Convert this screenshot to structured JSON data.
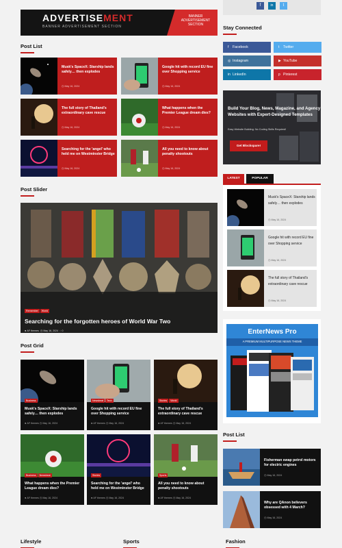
{
  "ad": {
    "title_main": "ADVERTISE",
    "title_accent": "MENT",
    "subtitle": "BANNER ADVERTISEMENT SECTION",
    "side_text": "BANNER ADVERTISEMENT SECTION"
  },
  "post_list": {
    "heading": "Post List",
    "items": [
      {
        "title": "Musk's SpaceX: Starship lands safely… then explodes",
        "date": "May 16, 2024"
      },
      {
        "title": "Google hit with record EU fine over Shopping service",
        "date": "May 16, 2024"
      },
      {
        "title": "The full story of Thailand's extraordinary cave rescue",
        "date": "May 16, 2024"
      },
      {
        "title": "What happens when the Premier League dream dies?",
        "date": "May 16, 2024"
      },
      {
        "title": "Searching for the 'angel' who held me on Westminster Bridge",
        "date": "May 16, 2024"
      },
      {
        "title": "All you need to know about penalty shootouts",
        "date": "May 16, 2024"
      }
    ]
  },
  "post_slider": {
    "heading": "Post Slider",
    "badges": [
      "Remember",
      "World"
    ],
    "title": "Searching for the forgotten heroes of World War Two",
    "author": "AF themes",
    "date": "May 16, 2024",
    "comments": "0"
  },
  "post_grid": {
    "heading": "Post Grid",
    "items": [
      {
        "badges": [
          "Business"
        ],
        "title": "Musk's SpaceX: Starship lands safely… then explodes",
        "author": "AF themes",
        "date": "May 16, 2024"
      },
      {
        "badges": [
          "Newsbeat",
          "Tech"
        ],
        "title": "Google hit with record EU fine over Shopping service",
        "author": "AF themes",
        "date": "May 16, 2024"
      },
      {
        "badges": [
          "Stories",
          "World"
        ],
        "title": "The full story of Thailand's extraordinary cave rescue",
        "author": "AF themes",
        "date": "May 16, 2024"
      },
      {
        "badges": [
          "Business",
          "Newsbeat"
        ],
        "title": "What happens when the Premier League dream dies?",
        "author": "AF themes",
        "date": "May 16, 2024"
      },
      {
        "badges": [
          "Stories"
        ],
        "title": "Searching for the 'angel' who held me on Westminster Bridge",
        "author": "AF themes",
        "date": "May 16, 2024"
      },
      {
        "badges": [
          "Sports"
        ],
        "title": "All you need to know about penalty shootouts",
        "author": "AF themes",
        "date": "May 16, 2024"
      }
    ]
  },
  "sidebar": {
    "stay_connected": "Stay Connected",
    "social": [
      {
        "label": "Facebook",
        "icon": "f",
        "color": "#3b5998"
      },
      {
        "label": "Twitter",
        "icon": "t",
        "color": "#55acee"
      },
      {
        "label": "Instagram",
        "icon": "◎",
        "color": "#3f729b"
      },
      {
        "label": "YouTube",
        "icon": "▶",
        "color": "#c4302b"
      },
      {
        "label": "LinkedIn",
        "icon": "in",
        "color": "#0e76a8"
      },
      {
        "label": "Pinterest",
        "icon": "p",
        "color": "#c8232c"
      }
    ],
    "promo": {
      "title": "Build Your Blog, News, Magazine, and Agency Websites with Expert-Designed Templates",
      "subtitle": "Easy Website Building: No Coding Skills Required!",
      "button": "Get Blockspare!"
    },
    "tabs": {
      "latest": "LATEST",
      "popular": "POPULAR"
    },
    "latest": [
      {
        "title": "Musk's SpaceX: Starship lands safely… then explodes",
        "date": "May 16, 2024"
      },
      {
        "title": "Google hit with record EU fine over Shopping service",
        "date": "May 16, 2024"
      },
      {
        "title": "The full story of Thailand's extraordinary cave rescue",
        "date": "May 16, 2024"
      }
    ],
    "enternews": {
      "title": "EnterNews Pro",
      "tagline": "A PREMIUM MULTIPURPOSE NEWS THEME"
    },
    "post_list_heading": "Post List",
    "post_list": [
      {
        "title": "Fisherman swap petrol motors for electric engines",
        "date": "May 16, 2024"
      },
      {
        "title": "Why are QAnon believers obsessed with 4 March?",
        "date": "May 16, 2024"
      }
    ]
  },
  "footer_headings": {
    "lifestyle": "Lifestyle",
    "sports": "Sports",
    "fashion": "Fashion"
  }
}
